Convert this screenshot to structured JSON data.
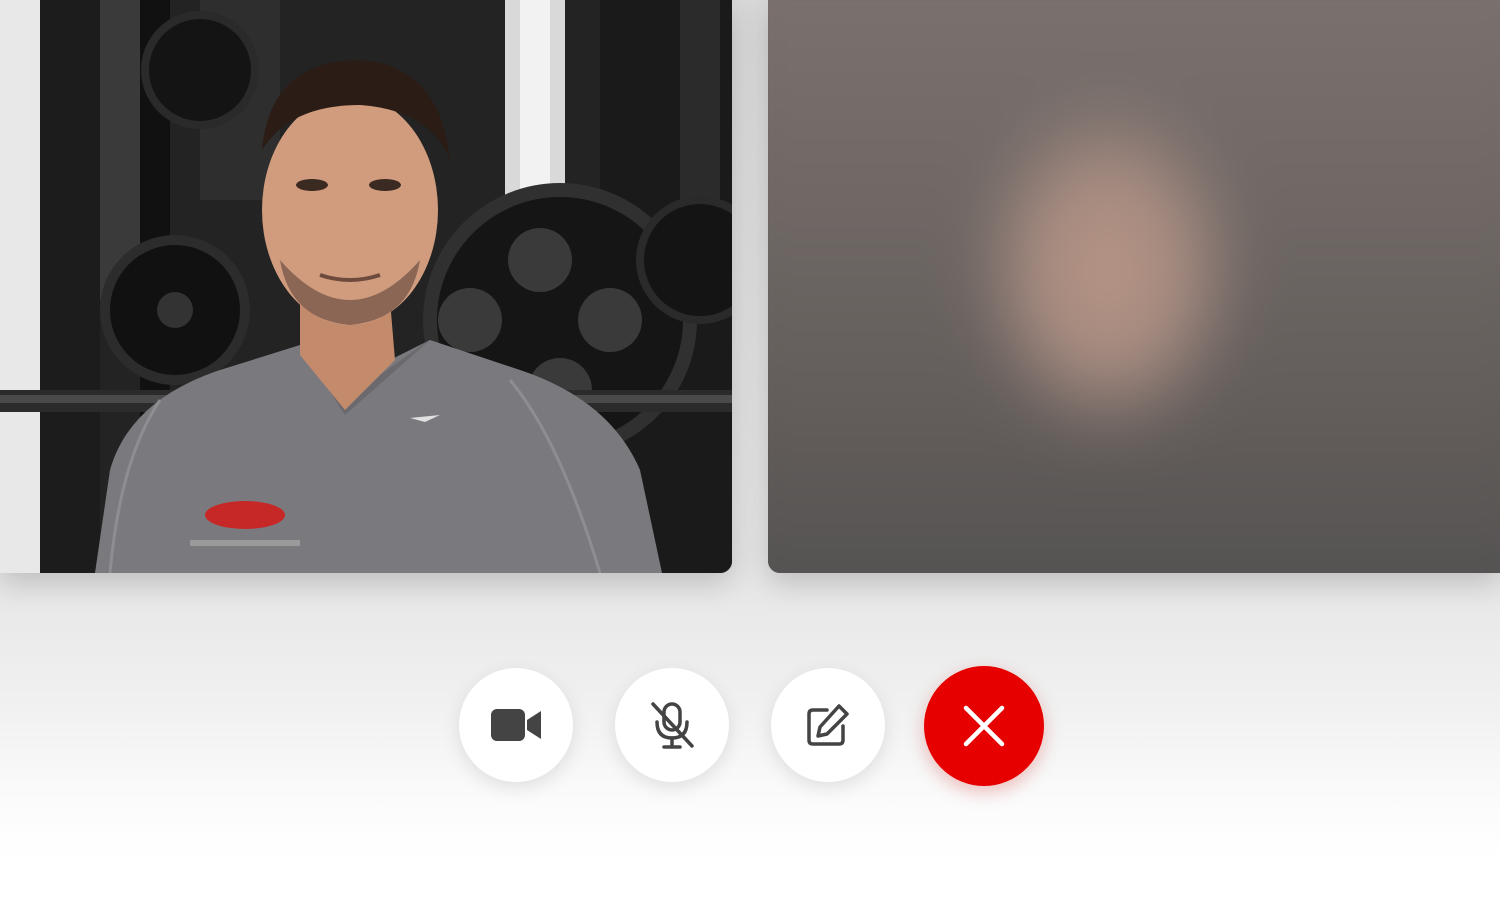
{
  "call": {
    "participants": [
      {
        "video_state": "on"
      },
      {
        "video_state": "blurred"
      }
    ]
  },
  "controls": {
    "camera": {
      "icon": "video-camera-icon",
      "state": "on"
    },
    "microphone": {
      "icon": "microphone-muted-icon",
      "state": "muted"
    },
    "edit": {
      "icon": "edit-icon"
    },
    "end_call": {
      "icon": "close-icon",
      "color": "#e60000"
    }
  },
  "colors": {
    "icon": "#444444",
    "end_call_bg": "#e60000",
    "button_bg": "#ffffff"
  }
}
